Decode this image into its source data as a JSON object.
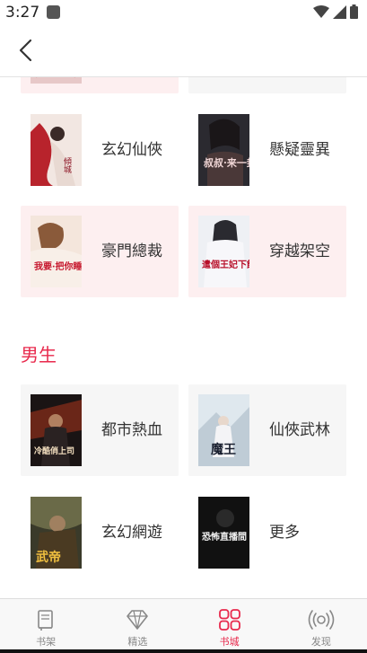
{
  "status_bar": {
    "time": "3:27"
  },
  "colors": {
    "accent": "#e8294c",
    "pink_card": "#fdeff0",
    "gray_card": "#f6f6f6"
  },
  "icons": {
    "back": "chevron-left-icon",
    "wifi": "wifi-icon",
    "signal": "signal-icon",
    "battery": "battery-icon"
  },
  "female_section": {
    "items": [
      {
        "label": "玄幻仙俠"
      },
      {
        "label": "懸疑靈異"
      },
      {
        "label": "豪門總裁"
      },
      {
        "label": "穿越架空"
      }
    ],
    "covers": [
      "",
      "叔叔·来一封",
      "我要·把你睡了",
      "遣個王妃下館罩"
    ]
  },
  "male_section": {
    "title": "男生",
    "items": [
      {
        "label": "都市熱血"
      },
      {
        "label": "仙俠武林"
      },
      {
        "label": "玄幻網遊"
      },
      {
        "label": "更多"
      }
    ],
    "covers": [
      "冷酷俏上司",
      "魔王",
      "武帝",
      "恐怖直播間"
    ]
  },
  "tab_bar": {
    "tabs": [
      {
        "label": "书架",
        "icon": "book-icon"
      },
      {
        "label": "精选",
        "icon": "diamond-icon"
      },
      {
        "label": "书城",
        "icon": "grid-icon",
        "active": true
      },
      {
        "label": "发现",
        "icon": "broadcast-icon"
      }
    ]
  }
}
